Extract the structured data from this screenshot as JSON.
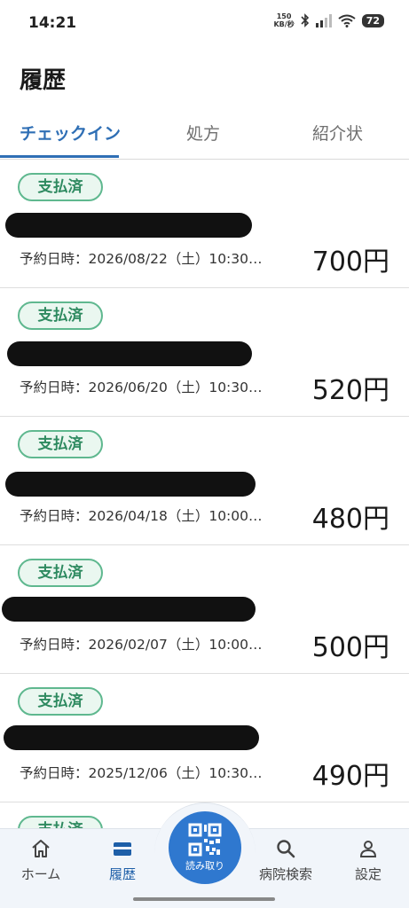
{
  "status": {
    "time": "14:21",
    "net_speed_value": "150",
    "net_speed_unit": "KB/秒",
    "battery": "72"
  },
  "page_title": "履歴",
  "tabs": [
    {
      "label": "チェックイン",
      "active": true
    },
    {
      "label": "処方",
      "active": false
    },
    {
      "label": "紹介状",
      "active": false
    }
  ],
  "items": [
    {
      "badge": "支払済",
      "date": "予約日時：2026/08/22（土）10:30…",
      "price": "700円"
    },
    {
      "badge": "支払済",
      "date": "予約日時：2026/06/20（土）10:30…",
      "price": "520円"
    },
    {
      "badge": "支払済",
      "date": "予約日時：2026/04/18（土）10:00…",
      "price": "480円"
    },
    {
      "badge": "支払済",
      "date": "予約日時：2026/02/07（土）10:00…",
      "price": "500円"
    },
    {
      "badge": "支払済",
      "date": "予約日時：2025/12/06（土）10:30…",
      "price": "490円"
    },
    {
      "badge": "支払済",
      "date": "",
      "price": ""
    }
  ],
  "nav": {
    "home": "ホーム",
    "history": "履歴",
    "scan": "読み取り",
    "search": "病院検索",
    "settings": "設定"
  },
  "colors": {
    "accent": "#2f6fb5",
    "paid_badge": "#2e8a60",
    "scan_button": "#2f78cf"
  }
}
